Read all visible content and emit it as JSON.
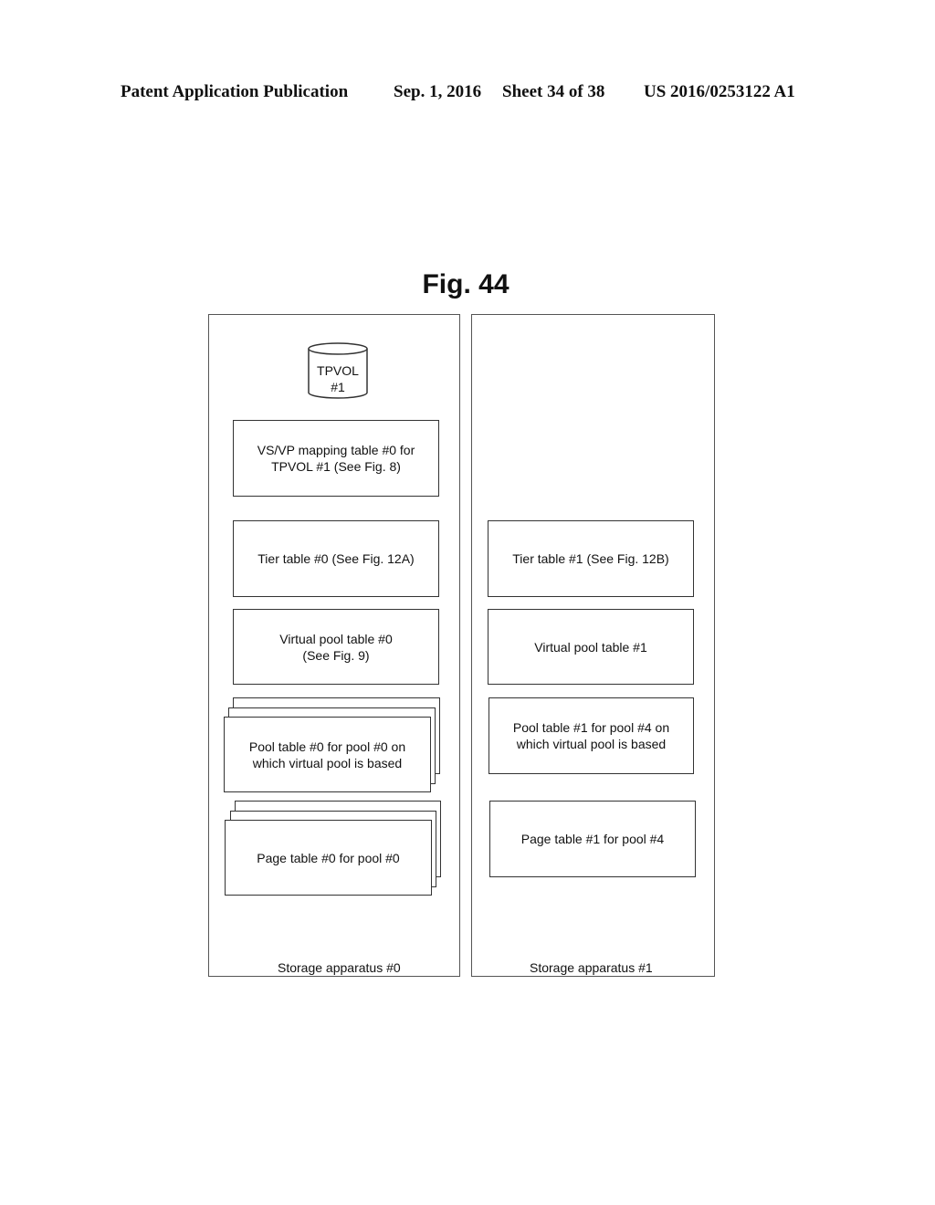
{
  "header": {
    "publication": "Patent Application Publication",
    "date": "Sep. 1, 2016",
    "sheet": "Sheet 34 of 38",
    "number": "US 2016/0253122 A1"
  },
  "figure": {
    "title": "Fig. 44"
  },
  "panels": [
    {
      "label": "Storage apparatus #0",
      "volume": "TPVOL\n#1",
      "boxes": [
        "VS/VP mapping table #0 for\nTPVOL #1 (See Fig. 8)",
        "Tier table #0 (See Fig. 12A)",
        "Virtual pool table #0\n(See Fig. 9)",
        "Pool table #0 for pool #0 on\nwhich virtual pool is based",
        "Page table #0 for pool #0"
      ]
    },
    {
      "label": "Storage apparatus #1",
      "boxes": [
        "Tier table #1 (See Fig. 12B)",
        "Virtual pool table #1",
        "Pool table #1 for pool #4 on\nwhich virtual pool is based",
        "Page table #1 for pool #4"
      ]
    }
  ]
}
